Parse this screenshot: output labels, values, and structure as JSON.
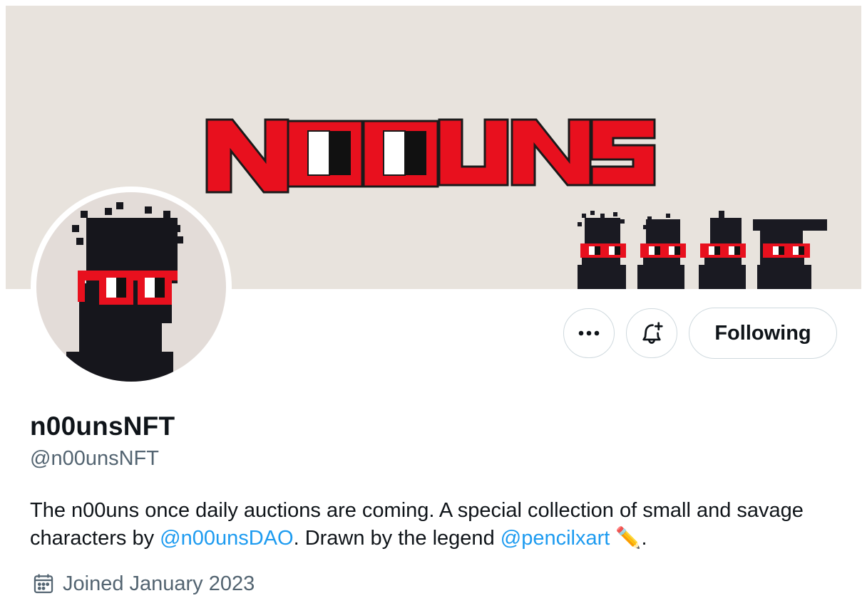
{
  "banner": {
    "logo_text": "N00UNS",
    "colors": {
      "background": "#e8e3dd",
      "logo_red": "#e8101e",
      "figure": "#1a1a22"
    }
  },
  "avatar": {
    "icon": "noun-pixel-avatar"
  },
  "actions": {
    "more_icon": "more-horizontal-icon",
    "notify_icon": "bell-plus-icon",
    "following_label": "Following"
  },
  "profile": {
    "display_name": "n00unsNFT",
    "handle": "@n00unsNFT",
    "bio": {
      "part1": "The n00uns once daily auctions are coming. A special collection of small and savage characters by ",
      "mention1": "@n00unsDAO",
      "part2": ". Drawn by the legend ",
      "mention2": "@pencilxart",
      "emoji": "✏️",
      "end": "."
    },
    "joined_icon": "calendar-icon",
    "joined": "Joined January 2023"
  },
  "colors": {
    "accent": "#1d9bf0",
    "secondary_text": "#536471",
    "border": "#cfd9de"
  }
}
